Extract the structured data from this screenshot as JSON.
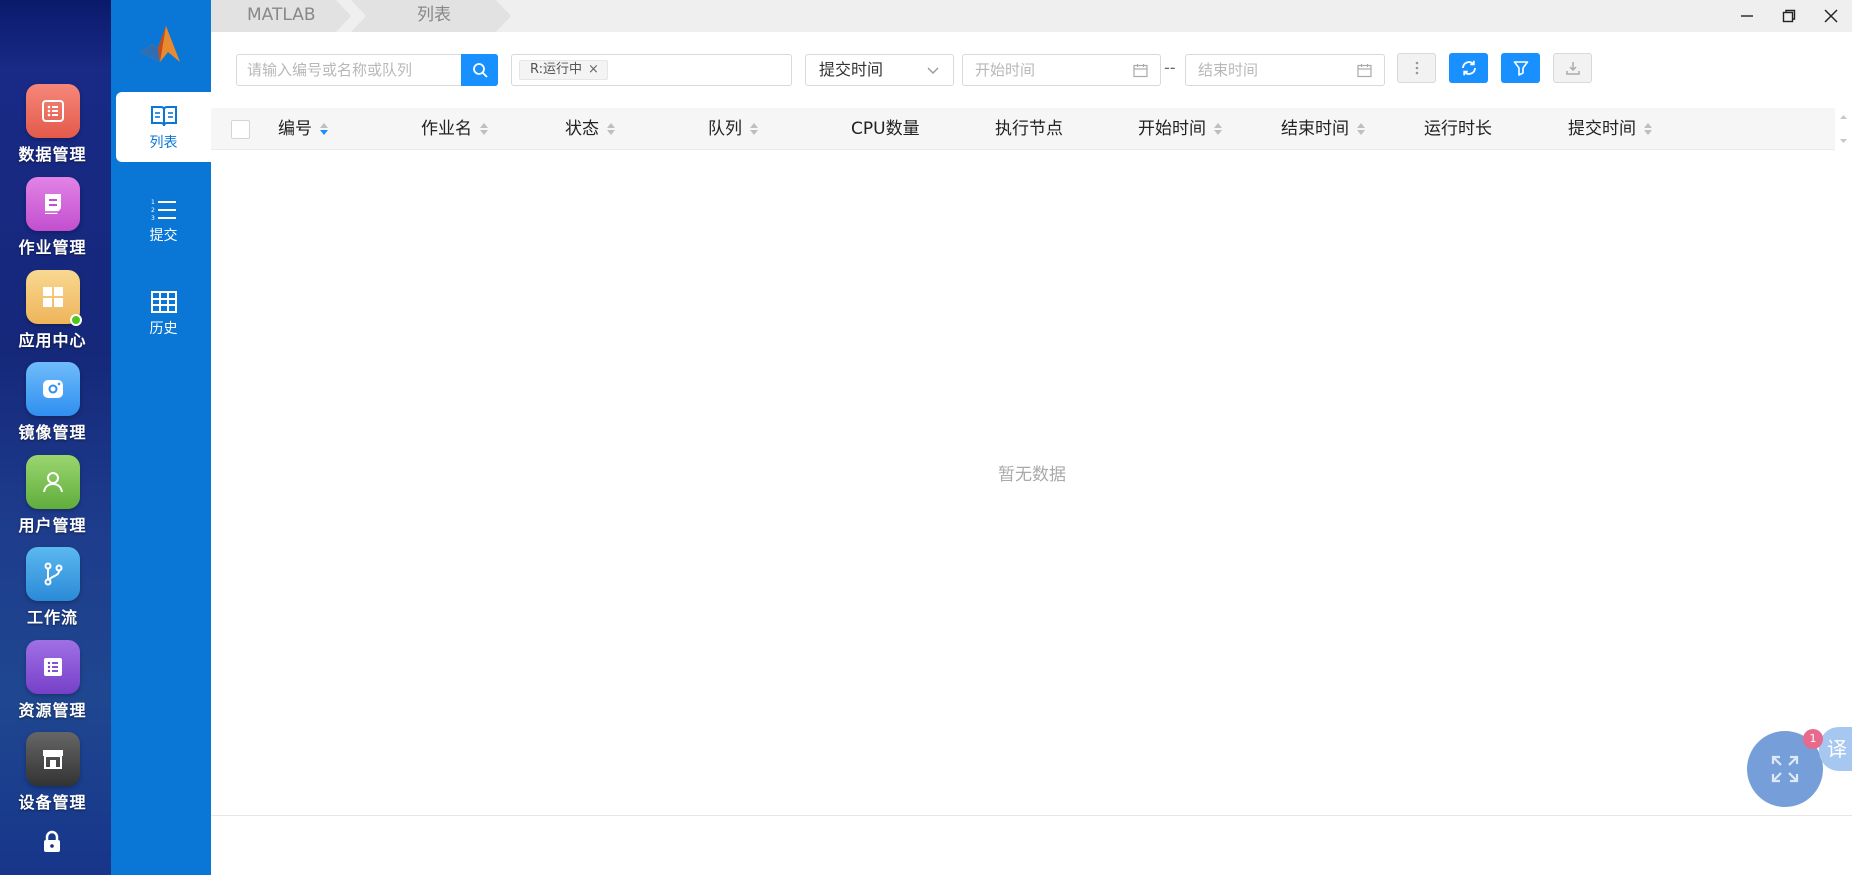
{
  "dock": {
    "items": [
      {
        "label": "数据管理",
        "icon": "data-management-icon",
        "color": "#ef6b5b"
      },
      {
        "label": "作业管理",
        "icon": "job-management-icon",
        "color": "#d665d6"
      },
      {
        "label": "应用中心",
        "icon": "app-center-icon",
        "color": "#f4c46a"
      },
      {
        "label": "镜像管理",
        "icon": "image-management-icon",
        "color": "#4aa8f5"
      },
      {
        "label": "用户管理",
        "icon": "user-management-icon",
        "color": "#7cc456"
      },
      {
        "label": "工作流",
        "icon": "workflow-icon",
        "color": "#3fa4e6"
      },
      {
        "label": "资源管理",
        "icon": "resource-management-icon",
        "color": "#8a52d8"
      },
      {
        "label": "设备管理",
        "icon": "device-management-icon",
        "color": "#4d4d4d"
      }
    ]
  },
  "subnav": {
    "items": [
      {
        "label": "列表",
        "icon": "book-icon"
      },
      {
        "label": "提交",
        "icon": "ordered-list-icon"
      },
      {
        "label": "历史",
        "icon": "table-grid-icon"
      }
    ]
  },
  "breadcrumb": {
    "app": "MATLAB",
    "page": "列表"
  },
  "toolbar": {
    "search_placeholder": "请输入编号或名称或队列",
    "filter_tag": "R:运行中",
    "time_field_select": "提交时间",
    "start_time_placeholder": "开始时间",
    "end_time_placeholder": "结束时间",
    "range_separator": "--"
  },
  "table": {
    "columns": [
      "编号",
      "作业名",
      "状态",
      "队列",
      "CPU数量",
      "执行节点",
      "开始时间",
      "结束时间",
      "运行时长",
      "提交时间"
    ],
    "empty_text": "暂无数据"
  },
  "widgets": {
    "translate_label": "译",
    "badge": "1"
  },
  "colors": {
    "primary": "#1890ff",
    "subnav_bg": "#0a77d6"
  }
}
